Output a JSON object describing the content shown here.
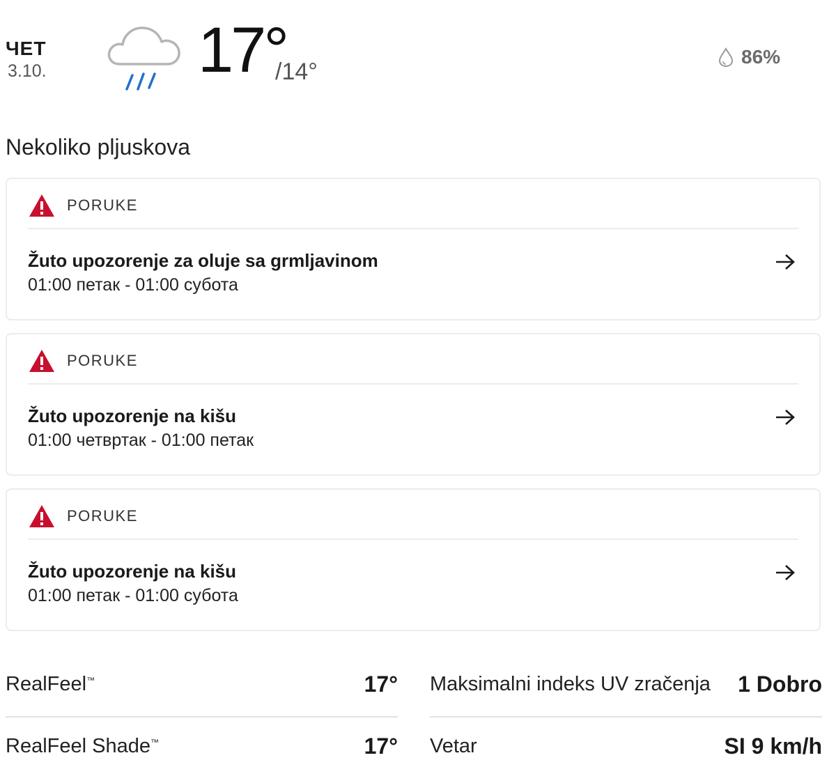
{
  "header": {
    "day": "ЧЕТ",
    "date": "3.10.",
    "weather_icon": "rain-cloud-icon",
    "temp_high": "17°",
    "temp_low": "/14°",
    "humidity_icon": "drop-icon",
    "humidity": "86%"
  },
  "phrase": "Nekoliko pljuskova",
  "alerts": [
    {
      "tag": "PORUKE",
      "title": "Žuto upozorenje za oluje sa grmljavinom",
      "time": "01:00 петак - 01:00 субота"
    },
    {
      "tag": "PORUKE",
      "title": "Žuto upozorenje na kišu",
      "time": "01:00 четвртак - 01:00 петак"
    },
    {
      "tag": "PORUKE",
      "title": "Žuto upozorenje na kišu",
      "time": "01:00 петак - 01:00 субота"
    }
  ],
  "stats": {
    "realfeel": {
      "label": "RealFeel",
      "tm": "™",
      "value": "17°"
    },
    "realfeel_shade": {
      "label": "RealFeel Shade",
      "tm": "™",
      "value": "17°"
    },
    "uv": {
      "label": "Maksimalni indeks UV zračenja",
      "value": "1 Dobro"
    },
    "wind": {
      "label": "Vetar",
      "value": "SI 9 km/h"
    }
  },
  "colors": {
    "alert_red": "#c8102e",
    "rain_blue": "#1f6fd1"
  }
}
